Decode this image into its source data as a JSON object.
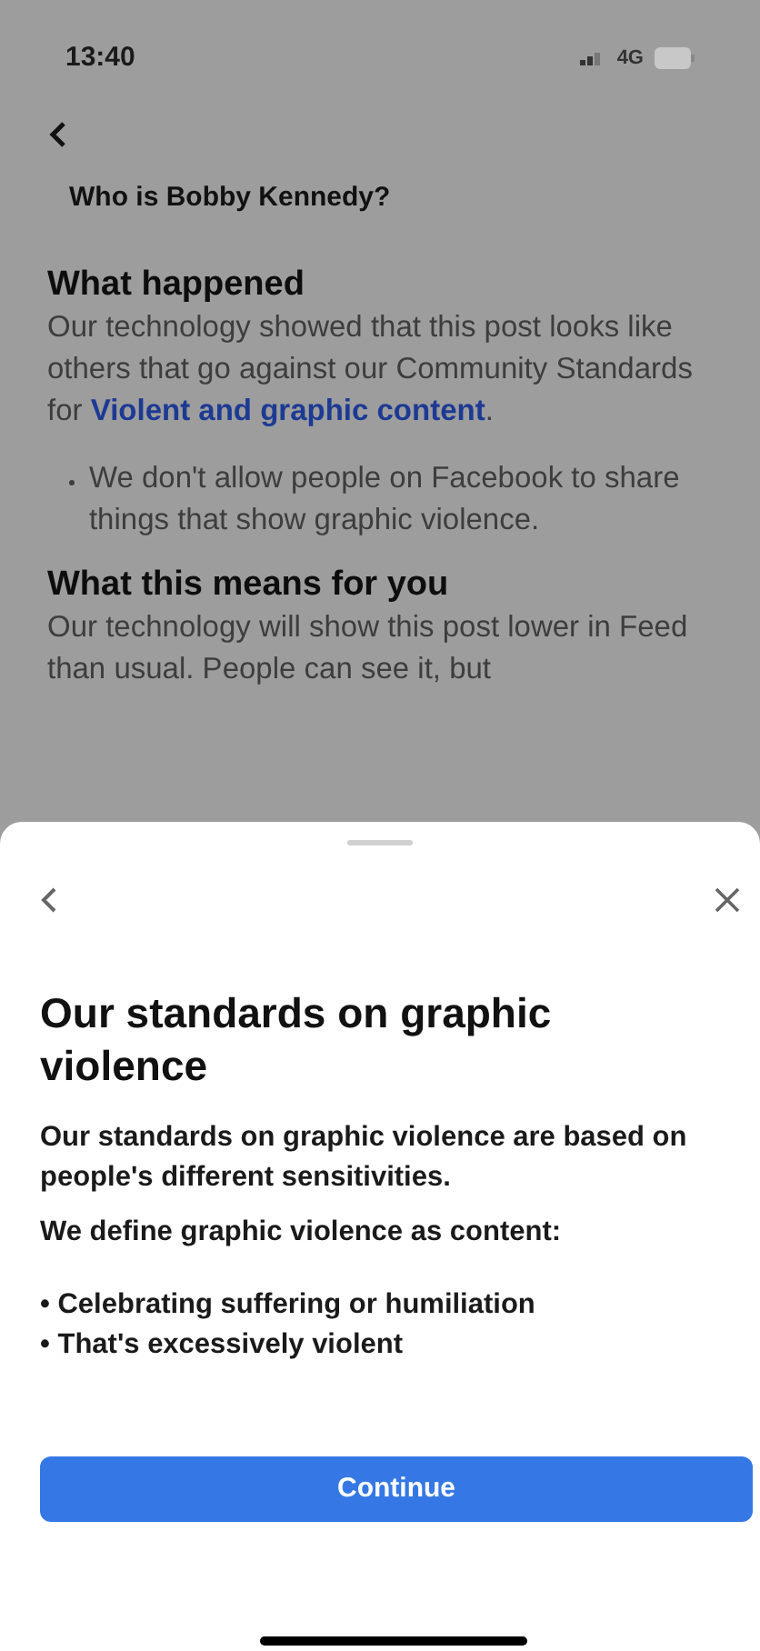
{
  "status_bar": {
    "time": "13:40",
    "network": "4G"
  },
  "page": {
    "title": "Who is Bobby Kennedy?",
    "sections": [
      {
        "heading": "What happened",
        "text": "Our technology showed that this post looks like others that go against our Community Standards for",
        "link": "Violent and graphic content",
        "after_link": ".",
        "bullets": [
          "We don't allow people on Facebook to share things that show graphic violence."
        ]
      },
      {
        "heading": "What this means for you",
        "text": "Our technology will show this post lower in Feed than usual. People can see it, but"
      }
    ]
  },
  "sheet": {
    "title": "Our standards on graphic violence",
    "paragraphs": [
      "Our standards on graphic violence are based on people's different sensitivities.",
      "We define graphic violence as content:"
    ],
    "bullets": [
      "• Celebrating suffering or humiliation",
      "• That's excessively violent"
    ],
    "button": "Continue"
  }
}
